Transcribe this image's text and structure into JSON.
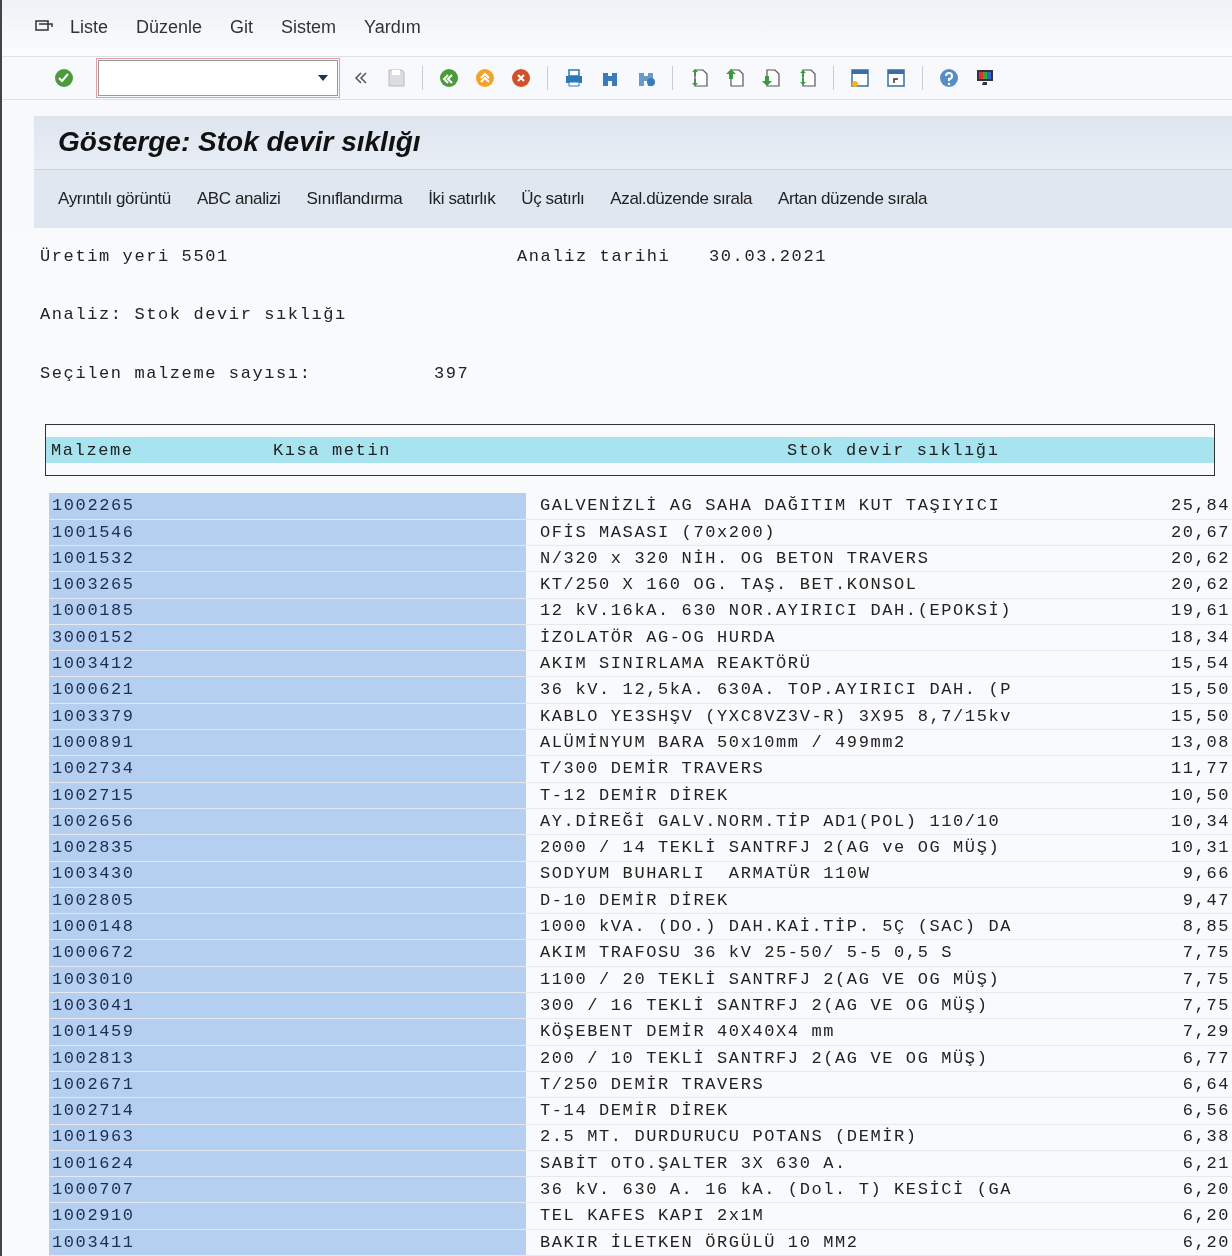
{
  "menu": [
    "Liste",
    "Düzenle",
    "Git",
    "Sistem",
    "Yardım"
  ],
  "title": "Gösterge: Stok devir sıklığı",
  "app_toolbar": [
    "Ayrıntılı görüntü",
    "ABC analizi",
    "Sınıflandırma",
    "İki satırlık",
    "Üç satırlı",
    "Azal.düzende sırala",
    "Artan düzende sırala"
  ],
  "header": {
    "plant": "Üretim yeri 5501",
    "date_label": "Analiz tarihi",
    "date": "30.03.2021",
    "analysis": "Analiz: Stok devir sıklığı",
    "count_label": "Seçilen malzeme sayısı:",
    "count": "397"
  },
  "table": {
    "columns": [
      "Malzeme",
      "Kısa metin",
      "Stok devir sıklığı"
    ],
    "rows": [
      {
        "material": "1002265",
        "text": "GALVENİZLİ AG SAHA DAĞITIM KUT TAŞIYICI",
        "value": "25,84"
      },
      {
        "material": "1001546",
        "text": "OFİS MASASI (70x200)",
        "value": "20,67"
      },
      {
        "material": "1001532",
        "text": "N/320 x 320 NİH. OG BETON TRAVERS",
        "value": "20,62"
      },
      {
        "material": "1003265",
        "text": "KT/250 X 160 OG. TAŞ. BET.KONSOL",
        "value": "20,62"
      },
      {
        "material": "1000185",
        "text": "12 kV.16kA. 630 NOR.AYIRICI DAH.(EPOKSİ)",
        "value": "19,61"
      },
      {
        "material": "3000152",
        "text": "İZOLATÖR AG-OG HURDA",
        "value": "18,34"
      },
      {
        "material": "1003412",
        "text": "AKIM SINIRLAMA REAKTÖRÜ",
        "value": "15,54"
      },
      {
        "material": "1000621",
        "text": "36 kV. 12,5kA. 630A. TOP.AYIRICI DAH. (P",
        "value": "15,50"
      },
      {
        "material": "1003379",
        "text": "KABLO YE3SHŞV (YXC8VZ3V-R) 3X95 8,7/15kv",
        "value": "15,50"
      },
      {
        "material": "1000891",
        "text": "ALÜMİNYUM BARA 50x10mm / 499mm2",
        "value": "13,08"
      },
      {
        "material": "1002734",
        "text": "T/300 DEMİR TRAVERS",
        "value": "11,77"
      },
      {
        "material": "1002715",
        "text": "T-12 DEMİR DİREK",
        "value": "10,50"
      },
      {
        "material": "1002656",
        "text": "AY.DİREĞİ GALV.NORM.TİP AD1(POL) 110/10",
        "value": "10,34"
      },
      {
        "material": "1002835",
        "text": "2000 / 14 TEKLİ SANTRFJ 2(AG ve OG MÜŞ)",
        "value": "10,31"
      },
      {
        "material": "1003430",
        "text": "SODYUM BUHARLI  ARMATÜR 110W",
        "value": "9,66"
      },
      {
        "material": "1002805",
        "text": "D-10 DEMİR DİREK",
        "value": "9,47"
      },
      {
        "material": "1000148",
        "text": "1000 kVA. (DO.) DAH.KAİ.TİP. 5Ç (SAC) DA",
        "value": "8,85"
      },
      {
        "material": "1000672",
        "text": "AKIM TRAFOSU 36 kV 25-50/ 5-5 0,5 S",
        "value": "7,75"
      },
      {
        "material": "1003010",
        "text": "1100 / 20 TEKLİ SANTRFJ 2(AG VE OG MÜŞ)",
        "value": "7,75"
      },
      {
        "material": "1003041",
        "text": "300 / 16 TEKLİ SANTRFJ 2(AG VE OG MÜŞ)",
        "value": "7,75"
      },
      {
        "material": "1001459",
        "text": "KÖŞEBENT DEMİR 40X40X4 mm",
        "value": "7,29"
      },
      {
        "material": "1002813",
        "text": "200 / 10 TEKLİ SANTRFJ 2(AG VE OG MÜŞ)",
        "value": "6,77"
      },
      {
        "material": "1002671",
        "text": "T/250 DEMİR TRAVERS",
        "value": "6,64"
      },
      {
        "material": "1002714",
        "text": "T-14 DEMİR DİREK",
        "value": "6,56"
      },
      {
        "material": "1001963",
        "text": "2.5 MT. DURDURUCU POTANS (DEMİR)",
        "value": "6,38"
      },
      {
        "material": "1001624",
        "text": "SABİT OTO.ŞALTER 3X 630 A.",
        "value": "6,21"
      },
      {
        "material": "1000707",
        "text": "36 kV. 630 A. 16 kA. (Dol. T) KESİCİ (GA",
        "value": "6,20"
      },
      {
        "material": "1002910",
        "text": "TEL KAFES KAPI 2x1M",
        "value": "6,20"
      },
      {
        "material": "1003411",
        "text": "BAKIR İLETKEN ÖRGÜLÜ 10 MM2",
        "value": "6,20"
      }
    ]
  }
}
